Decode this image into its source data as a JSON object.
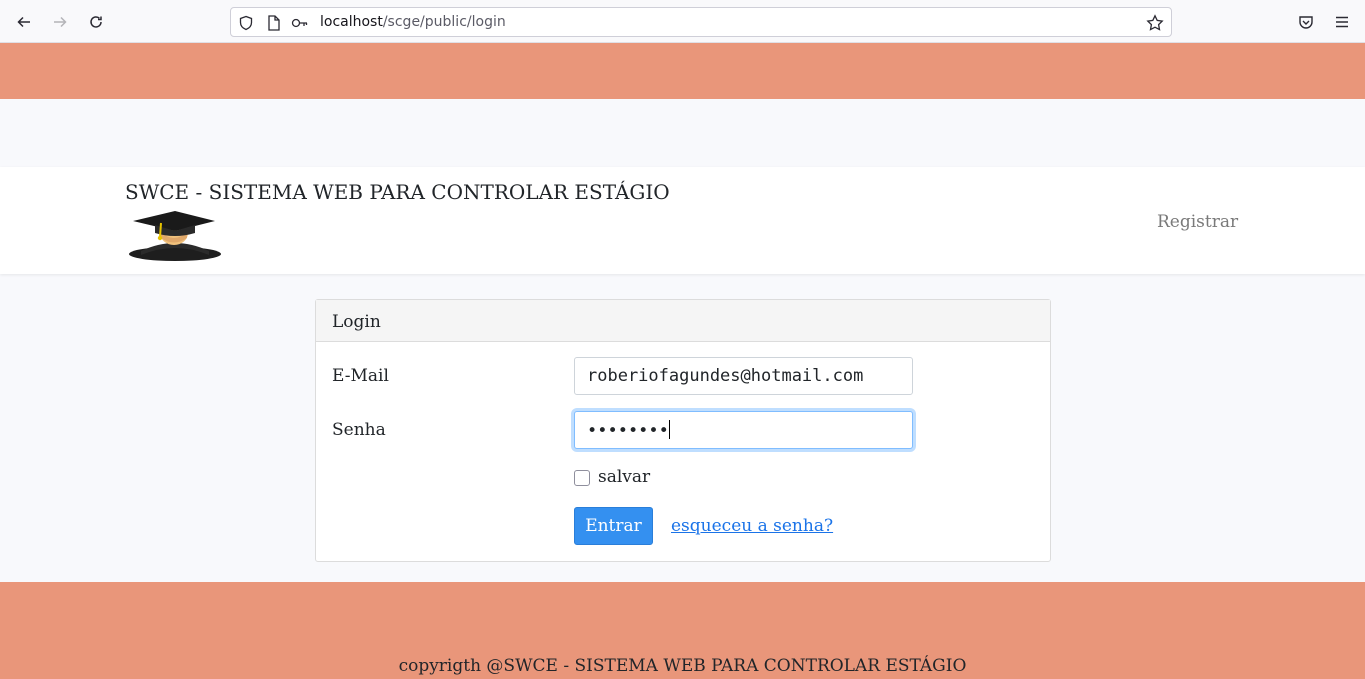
{
  "browser": {
    "url_host": "localhost",
    "url_path": "/scge/public/login",
    "icons": [
      "back-icon",
      "forward-icon",
      "reload-icon",
      "shield-icon",
      "page-icon",
      "key-icon",
      "star-icon",
      "pocket-icon",
      "menu-icon"
    ]
  },
  "header": {
    "brand": "SWCE - SISTEMA WEB PARA CONTROLAR ESTÁGIO",
    "register_link": "Registrar"
  },
  "login": {
    "title": "Login",
    "email_label": "E-Mail",
    "email_value": "roberiofagundes@hotmail.com",
    "password_label": "Senha",
    "password_value": "••••••••",
    "remember_label": "salvar",
    "remember_checked": false,
    "submit_label": "Entrar",
    "forgot_link": "esqueceu a senha?"
  },
  "footer": {
    "copyright": "copyrigth @SWCE - SISTEMA WEB PARA CONTROLAR ESTÁGIO"
  },
  "colors": {
    "band": "#e9967a",
    "primary": "#3490f0",
    "link": "#1a73e8"
  }
}
